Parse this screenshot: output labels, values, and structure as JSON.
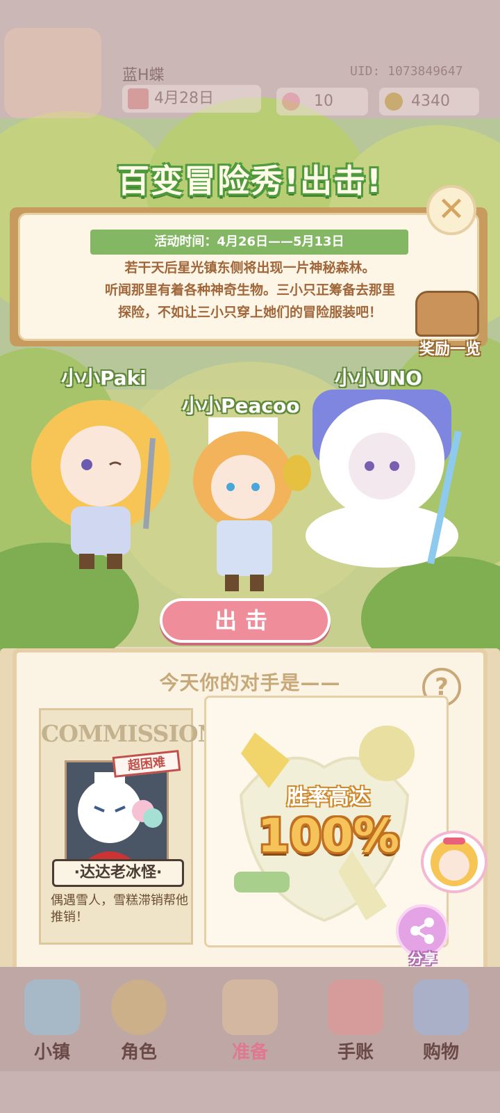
{
  "top_bar": {
    "username": "蓝H蝶",
    "uid_label": "UID: 1073849647",
    "date_text": "4月28日",
    "gems": "10",
    "coins": "4340"
  },
  "popup": {
    "title": "百变冒险秀!出击!",
    "activity_time": "活动时间：4月26日——5月13日",
    "description_lines": [
      "若干天后星光镇东侧将出现一片神秘森林。",
      "听闻那里有着各种神奇生物。三小只正筹备去那里",
      "探险，不如让三小只穿上她们的冒险服装吧！"
    ],
    "close_icon": "close-icon",
    "reward_label": "奖励一览",
    "characters": [
      "小小Paki",
      "小小Peacoo",
      "小小UNO"
    ],
    "go_button": "出击"
  },
  "opponent": {
    "heading": "今天你的对手是——",
    "help_symbol": "?",
    "poster_header": "COMMISSION",
    "difficulty_stamp": "超困难",
    "boss_name": "·达达老冰怪·",
    "boss_description": "偶遇雪人，雪糕滞销帮他推销！",
    "win_rate_label": "胜率高达",
    "win_rate_value": "100%",
    "share_label": "分享"
  },
  "nav": {
    "items": [
      "小镇",
      "角色",
      "准备",
      "手账",
      "购物"
    ]
  },
  "colors": {
    "title_green": "#4f9a3c",
    "ribbon_green": "#84b764",
    "text_brown": "#a0663a",
    "button_pink": "#ef8e9a"
  }
}
